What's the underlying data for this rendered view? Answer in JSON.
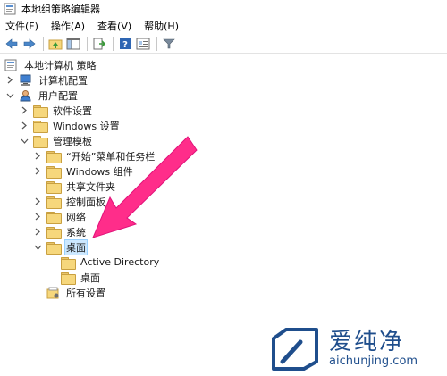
{
  "window": {
    "title": "本地组策略编辑器"
  },
  "menu": [
    {
      "label": "文件(F)"
    },
    {
      "label": "操作(A)"
    },
    {
      "label": "查看(V)"
    },
    {
      "label": "帮助(H)"
    }
  ],
  "toolbar": {
    "icons": [
      "back-icon",
      "forward-icon",
      "up-folder-icon",
      "show-hide-tree-icon",
      "export-list-icon",
      "help-icon",
      "properties-icon",
      "filter-icon"
    ]
  },
  "tree": {
    "root": "本地计算机 策略",
    "computer_config": "计算机配置",
    "user_config": "用户配置",
    "software_settings": "软件设置",
    "windows_settings": "Windows 设置",
    "admin_templates": "管理模板",
    "start_menu": "“开始”菜单和任务栏",
    "windows_components": "Windows 组件",
    "shared_folders": "共享文件夹",
    "control_panel": "控制面板",
    "network": "网络",
    "system": "系统",
    "desktop": "桌面",
    "active_directory": "Active Directory",
    "desktop_child": "桌面",
    "all_settings": "所有设置"
  },
  "colors": {
    "annotation_arrow": "#ff2d8a",
    "selection": "#cce8ff",
    "folder": "#f6d77c",
    "watermark": "#1f4e8c"
  },
  "watermark": {
    "brand": "爱纯净",
    "url": "aichunjing.com"
  }
}
